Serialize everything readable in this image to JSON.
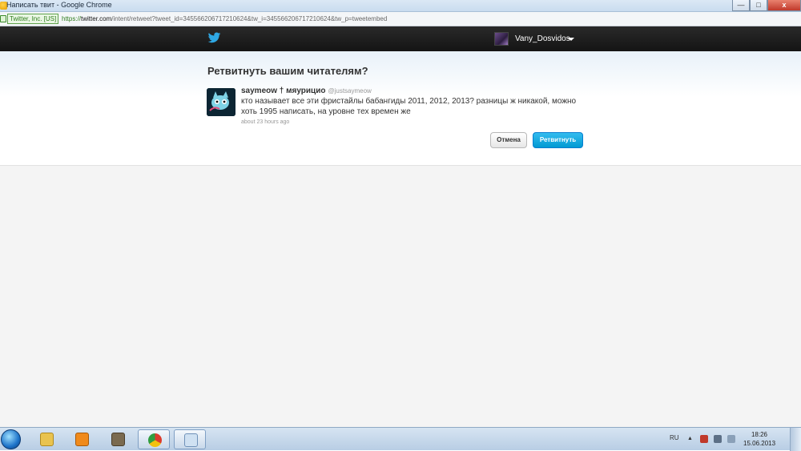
{
  "window": {
    "title": "Написать твит - Google Chrome",
    "minimize": "—",
    "maximize": "□",
    "close": "x"
  },
  "address": {
    "ev_badge": "Twitter, Inc. [US]",
    "scheme": "https://",
    "host": "twitter.com",
    "path": "/intent/retweet?tweet_id=345566206717210624&tw_i=345566206717210624&tw_p=tweetembed"
  },
  "topbar": {
    "username": "Vany_Dosvidos"
  },
  "dialog": {
    "title": "Ретвитнуть вашим читателям?",
    "tweet": {
      "author_name": "saymeow † мяурициo",
      "author_handle": "@justsaymeow",
      "text": "кто называет все эти фристайлы бабангиды 2011, 2012, 2013? разницы ж никакой, можно хоть 1995 написать, на уровне тех времен же",
      "timestamp": "about 23 hours ago"
    },
    "cancel_label": "Отмена",
    "retweet_label": "Ретвитнуть"
  },
  "taskbar": {
    "items": [
      {
        "name": "explorer",
        "color": "#e9c34f"
      },
      {
        "name": "media-player",
        "color": "#f08a1c"
      },
      {
        "name": "archive",
        "color": "#7a6a50"
      },
      {
        "name": "chrome",
        "color": "#2f9d3f"
      },
      {
        "name": "paint",
        "color": "#8ab0d8"
      }
    ],
    "lang": "RU",
    "time": "18:26",
    "date": "15.06.2013"
  }
}
